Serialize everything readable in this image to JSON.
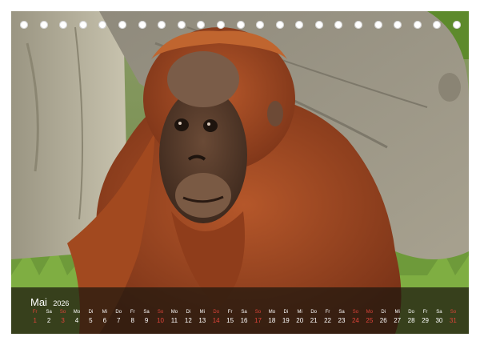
{
  "calendar": {
    "month": "Mai",
    "year": "2026",
    "days": [
      {
        "dn": "Fr",
        "dd": "1",
        "red": true
      },
      {
        "dn": "Sa",
        "dd": "2",
        "red": false
      },
      {
        "dn": "So",
        "dd": "3",
        "red": true
      },
      {
        "dn": "Mo",
        "dd": "4",
        "red": false
      },
      {
        "dn": "Di",
        "dd": "5",
        "red": false
      },
      {
        "dn": "Mi",
        "dd": "6",
        "red": false
      },
      {
        "dn": "Do",
        "dd": "7",
        "red": false
      },
      {
        "dn": "Fr",
        "dd": "8",
        "red": false
      },
      {
        "dn": "Sa",
        "dd": "9",
        "red": false
      },
      {
        "dn": "So",
        "dd": "10",
        "red": true
      },
      {
        "dn": "Mo",
        "dd": "11",
        "red": false
      },
      {
        "dn": "Di",
        "dd": "12",
        "red": false
      },
      {
        "dn": "Mi",
        "dd": "13",
        "red": false
      },
      {
        "dn": "Do",
        "dd": "14",
        "red": true
      },
      {
        "dn": "Fr",
        "dd": "15",
        "red": false
      },
      {
        "dn": "Sa",
        "dd": "16",
        "red": false
      },
      {
        "dn": "So",
        "dd": "17",
        "red": true
      },
      {
        "dn": "Mo",
        "dd": "18",
        "red": false
      },
      {
        "dn": "Di",
        "dd": "19",
        "red": false
      },
      {
        "dn": "Mi",
        "dd": "20",
        "red": false
      },
      {
        "dn": "Do",
        "dd": "21",
        "red": false
      },
      {
        "dn": "Fr",
        "dd": "22",
        "red": false
      },
      {
        "dn": "Sa",
        "dd": "23",
        "red": false
      },
      {
        "dn": "So",
        "dd": "24",
        "red": true
      },
      {
        "dn": "Mo",
        "dd": "25",
        "red": true
      },
      {
        "dn": "Di",
        "dd": "26",
        "red": false
      },
      {
        "dn": "Mi",
        "dd": "27",
        "red": false
      },
      {
        "dn": "Do",
        "dd": "28",
        "red": false
      },
      {
        "dn": "Fr",
        "dd": "29",
        "red": false
      },
      {
        "dn": "Sa",
        "dd": "30",
        "red": false
      },
      {
        "dn": "So",
        "dd": "31",
        "red": true
      }
    ]
  },
  "colors": {
    "holiday": "#e0443a",
    "band": "#1c160e"
  }
}
